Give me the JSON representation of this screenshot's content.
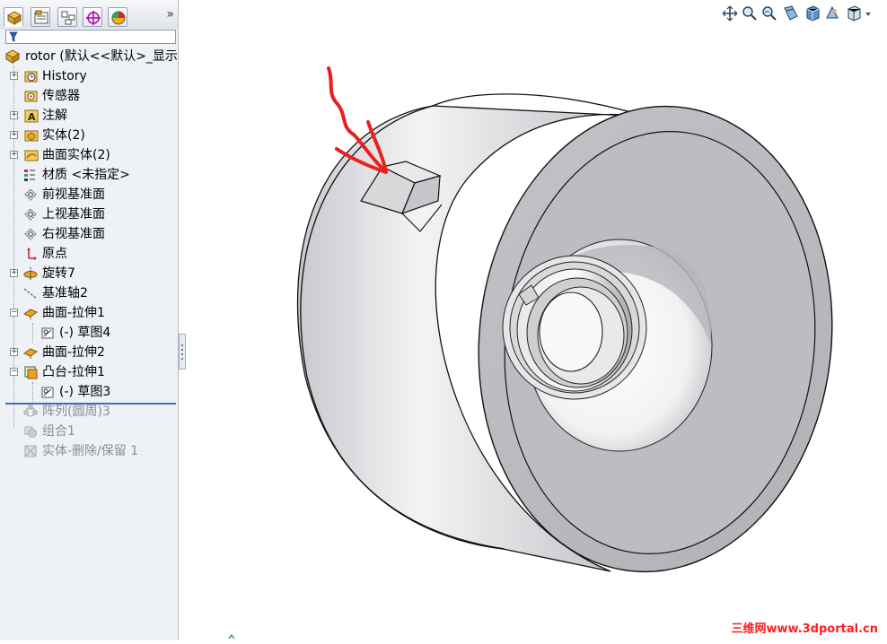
{
  "panel": {
    "collapse_glyph": "»",
    "tabs": [
      "featuremanager-icon",
      "propertymanager-icon",
      "configurationmanager-icon",
      "dimxpert-icon",
      "display-manager-icon"
    ],
    "root": {
      "label": "rotor  (默认<<默认>_显示"
    },
    "items": [
      {
        "label": "History",
        "icon": "history-icon",
        "expandable": true
      },
      {
        "label": "传感器",
        "icon": "sensors-icon",
        "expandable": false
      },
      {
        "label": "注解",
        "icon": "annotations-icon",
        "expandable": true
      },
      {
        "label": "实体(2)",
        "icon": "solid-bodies-icon",
        "expandable": true
      },
      {
        "label": "曲面实体(2)",
        "icon": "surface-bodies-icon",
        "expandable": true
      },
      {
        "label": "材质 <未指定>",
        "icon": "material-icon",
        "expandable": false
      },
      {
        "label": "前视基准面",
        "icon": "plane-icon",
        "expandable": false
      },
      {
        "label": "上视基准面",
        "icon": "plane-icon",
        "expandable": false
      },
      {
        "label": "右视基准面",
        "icon": "plane-icon",
        "expandable": false
      },
      {
        "label": "原点",
        "icon": "origin-icon",
        "expandable": false
      },
      {
        "label": "旋转7",
        "icon": "revolve-icon",
        "expandable": true
      },
      {
        "label": "基准轴2",
        "icon": "axis-icon",
        "expandable": false
      },
      {
        "label": "曲面-拉伸1",
        "icon": "surface-extrude-icon",
        "expandable": true,
        "expanded": true
      },
      {
        "label": "(-) 草图4",
        "icon": "sketch-icon",
        "child": true
      },
      {
        "label": "曲面-拉伸2",
        "icon": "surface-extrude-icon",
        "expandable": true
      },
      {
        "label": "凸台-拉伸1",
        "icon": "boss-extrude-icon",
        "expandable": true,
        "expanded": true
      },
      {
        "label": "(-) 草图3",
        "icon": "sketch-icon",
        "child": true
      },
      {
        "label": "阵列(圆周)3",
        "icon": "circular-pattern-icon",
        "suppressed": true
      },
      {
        "label": "组合1",
        "icon": "combine-icon",
        "suppressed": true
      },
      {
        "label": "实体-删除/保留 1",
        "icon": "delete-body-icon",
        "suppressed": true
      }
    ]
  },
  "viewport": {
    "heads_up_tools": [
      "zoom-to-fit-icon",
      "zoom-to-area-icon",
      "previous-view-icon",
      "section-view-icon",
      "view-orientation-icon",
      "display-style-icon",
      "hide-show-items-icon",
      "dropdown-icon"
    ],
    "watermark": {
      "cn": "三维网",
      "url": "www.3dportal.cn"
    },
    "annotation_color": "#e8201f",
    "part_fill": "#b9b8bd"
  }
}
